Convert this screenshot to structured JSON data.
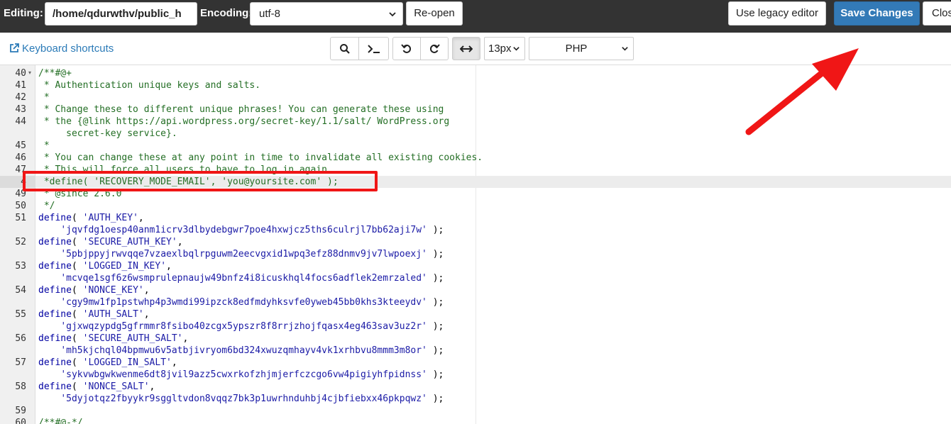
{
  "header": {
    "editing_label": "Editing:",
    "file_path": "/home/qdurwthv/public_h",
    "encoding_label": "Encoding:",
    "encoding_value": "utf-8",
    "reopen_label": "Re-open",
    "legacy_label": "Use legacy editor",
    "save_label": "Save Changes",
    "close_label": "Clos"
  },
  "toolbar": {
    "keyboard_shortcuts": "Keyboard shortcuts",
    "font_size": "13px",
    "language": "PHP",
    "icons": [
      "search-icon",
      "terminal-icon",
      "undo-icon",
      "redo-icon",
      "wrap-toggle-icon"
    ]
  },
  "editor": {
    "active_line_number": "4",
    "lines": [
      {
        "n": "40",
        "text": "/**#@+"
      },
      {
        "n": "41",
        "text": " * Authentication unique keys and salts."
      },
      {
        "n": "42",
        "text": " *"
      },
      {
        "n": "43",
        "text": " * Change these to different unique phrases! You can generate these using"
      },
      {
        "n": "44",
        "text": " * the {@link https://api.wordpress.org/secret-key/1.1/salt/ WordPress.org"
      },
      {
        "n": "",
        "text": "     secret-key service}."
      },
      {
        "n": "45",
        "text": " *"
      },
      {
        "n": "46",
        "text": " * You can change these at any point in time to invalidate all existing cookies."
      },
      {
        "n": "47",
        "text": " * This will force all users to have to log in again."
      },
      {
        "n": "4",
        "text": " *define( 'RECOVERY_MODE_EMAIL', 'you@yoursite.com' );"
      },
      {
        "n": "49",
        "text": " * @since 2.6.0"
      },
      {
        "n": "50",
        "text": " */"
      },
      {
        "n": "51",
        "text": "define( 'AUTH_KEY',"
      },
      {
        "n": "",
        "text": "    'jqvfdg1oesp40anm1icrv3dlbydebgwr7poe4hxwjcz5ths6culrjl7bb62aji7w' );"
      },
      {
        "n": "52",
        "text": "define( 'SECURE_AUTH_KEY',"
      },
      {
        "n": "",
        "text": "    '5pbjppyjrwvqqe7vzaexlbqlrpguwm2eecvgxid1wpq3efz88dnmv9jv7lwpoexj' );"
      },
      {
        "n": "53",
        "text": "define( 'LOGGED_IN_KEY',"
      },
      {
        "n": "",
        "text": "    'mcvqe1sgf6z6wsmprulepnaujw49bnfz4i8icuskhql4focs6adflek2emrzaled' );"
      },
      {
        "n": "54",
        "text": "define( 'NONCE_KEY',"
      },
      {
        "n": "",
        "text": "    'cgy9mw1fp1pstwhp4p3wmdi99ipzck8edfmdyhksvfe0yweb45bb0khs3kteeydv' );"
      },
      {
        "n": "55",
        "text": "define( 'AUTH_SALT',"
      },
      {
        "n": "",
        "text": "    'gjxwqzypdg5gfrmmr8fsibo40zcgx5ypszr8f8rrjzhojfqasx4eg463sav3uz2r' );"
      },
      {
        "n": "56",
        "text": "define( 'SECURE_AUTH_SALT',"
      },
      {
        "n": "",
        "text": "    'mh5kjchql04bpmwu6v5atbjivryom6bd324xwuzqmhayv4vk1xrhbvu8mmm3m8or' );"
      },
      {
        "n": "57",
        "text": "define( 'LOGGED_IN_SALT',"
      },
      {
        "n": "",
        "text": "    'sykvwbgwkwenme6dt8jvil9azz5cwxrkofzhjmjerfczcgo6vw4pigiyhfpidnss' );"
      },
      {
        "n": "58",
        "text": "define( 'NONCE_SALT',"
      },
      {
        "n": "",
        "text": "    '5dyjotqz2fbyykr9sggltvdon8vqqz7bk3p1uwrhnduhbj4cjbfiebxx46pkpqwz' );"
      },
      {
        "n": "59",
        "text": ""
      },
      {
        "n": "60",
        "text": "/**#@-*/"
      }
    ]
  },
  "colors": {
    "topbar": "#333333",
    "save_button": "#337ab7",
    "annotation_red": "#f01616",
    "link_blue": "#2a7ab7"
  }
}
